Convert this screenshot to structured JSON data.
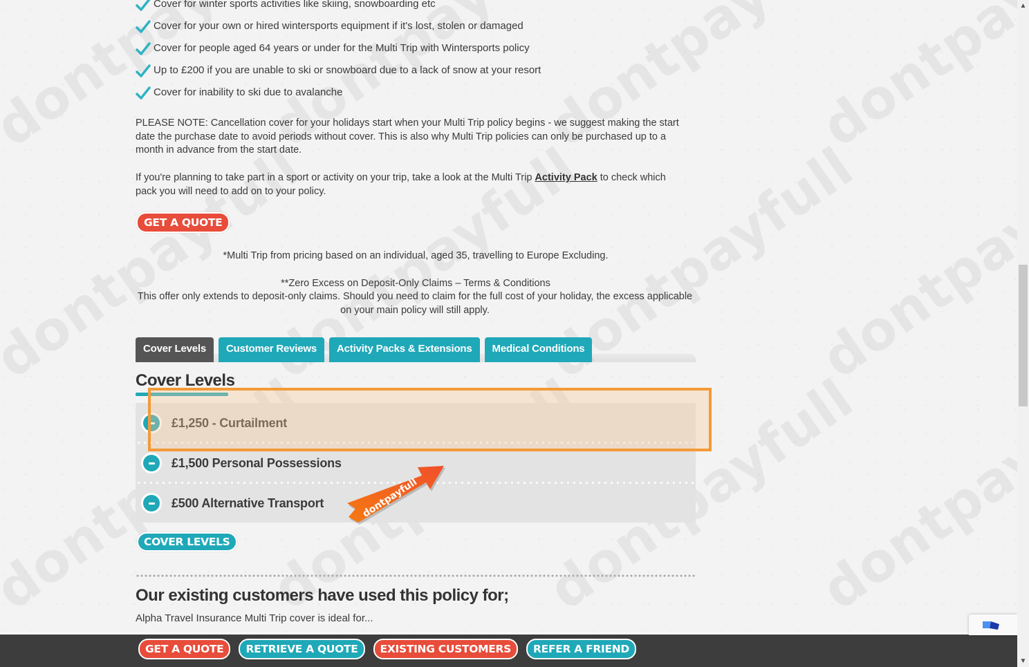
{
  "features": [
    "Cover for winter sports activities like skiing, snowboarding etc",
    "Cover for your own or hired wintersports equipment if it's lost, stolen or damaged",
    "Cover for people aged 64 years or under for the Multi Trip with Wintersports policy",
    "Up to £200 if you are unable to ski or snowboard due to a lack of snow at your resort",
    "Cover for inability to ski due to avalanche"
  ],
  "note": "PLEASE NOTE: Cancellation cover for your holidays start when your Multi Trip policy begins - we suggest making the start date the purchase date to avoid periods without cover. This is also why Multi Trip policies can only be purchased up to a month in advance from the start date.",
  "activity": {
    "before": "If you're planning to take part in a sport or activity on your trip, take a look at the Multi Trip ",
    "link": "Activity Pack",
    "after": " to check which pack you will need to add on to your policy."
  },
  "get_quote_label": "GET A QUOTE",
  "pricing_note": "*Multi Trip from pricing based on an individual, aged 35, travelling to Europe Excluding.",
  "excess": {
    "title": "**Zero Excess on Deposit-Only Claims – Terms & Conditions",
    "body": "This offer only extends to deposit-only claims. Should you need to claim for the full cost of your holiday, the excess applicable on your main policy will still apply."
  },
  "tabs": [
    {
      "label": "Cover Levels",
      "active": true
    },
    {
      "label": "Customer Reviews",
      "active": false
    },
    {
      "label": "Activity Packs & Extensions",
      "active": false
    },
    {
      "label": "Medical Conditions",
      "active": false
    }
  ],
  "cover_heading": "Cover Levels",
  "cover_items": [
    "£1,250 - Curtailment",
    "£1,500 Personal Possessions",
    "£500 Alternative Transport"
  ],
  "cover_levels_btn": "COVER LEVELS",
  "badge_text": "dontpayfull",
  "customers_heading": "Our existing customers have used this policy for;",
  "customers_sub": "Alpha Travel Insurance Multi Trip cover is ideal for...",
  "footer_buttons": [
    {
      "label": "GET A QUOTE",
      "color": "red"
    },
    {
      "label": "RETRIEVE A QUOTE",
      "color": "teal"
    },
    {
      "label": "EXISTING CUSTOMERS",
      "color": "red"
    },
    {
      "label": "REFER A FRIEND",
      "color": "teal"
    }
  ],
  "watermark_text": "dontpayfull",
  "colors": {
    "teal": "#1fa8b8",
    "red": "#e84c3a",
    "highlight": "#f39a37",
    "tab_active": "#555555",
    "footer": "#3d3d3d"
  }
}
